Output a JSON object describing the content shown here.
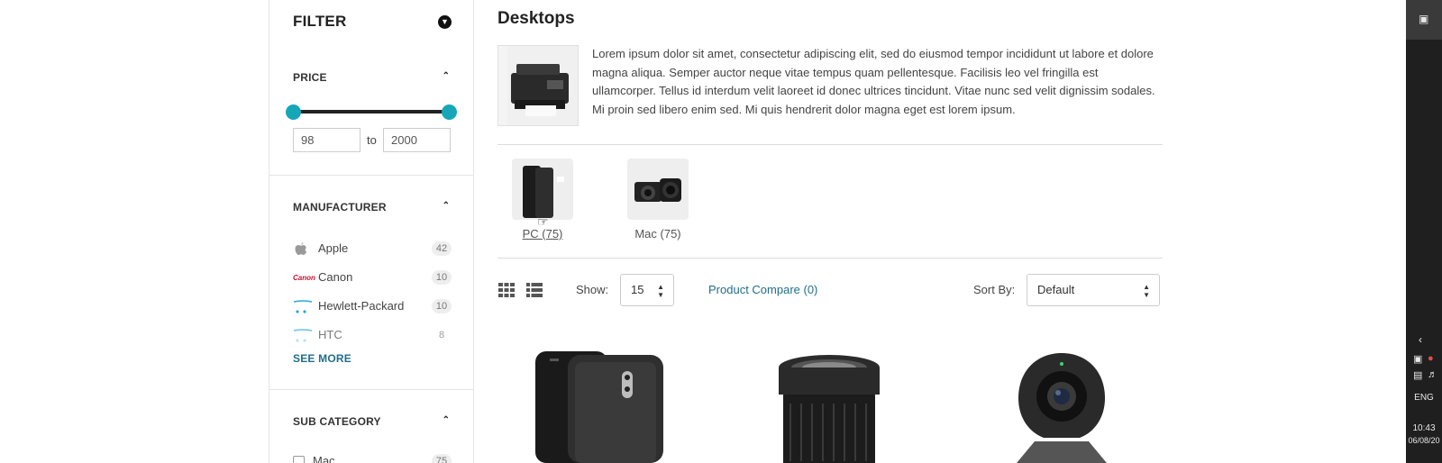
{
  "sidebar": {
    "filter_title": "FILTER",
    "price": {
      "title": "PRICE",
      "min_value": "98",
      "max_value": "2000",
      "to_label": "to",
      "accent": "#17a6b8"
    },
    "manufacturer": {
      "title": "MANUFACTURER",
      "items": [
        {
          "label": "Apple",
          "count": "42",
          "logo": "apple-logo"
        },
        {
          "label": "Canon",
          "count": "10",
          "logo": "Canon"
        },
        {
          "label": "Hewlett-Packard",
          "count": "10",
          "logo": "hp-logo"
        },
        {
          "label": "HTC",
          "count": "8",
          "logo": "htc-logo"
        }
      ],
      "see_more": "SEE MORE"
    },
    "sub_category": {
      "title": "SUB CATEGORY",
      "items": [
        {
          "label": "Mac",
          "count": "75"
        }
      ]
    }
  },
  "main": {
    "title": "Desktops",
    "description": "Lorem ipsum dolor sit amet, consectetur adipiscing elit, sed do eiusmod tempor incididunt ut labore et dolore magna aliqua. Semper auctor neque vitae tempus quam pellentesque. Facilisis leo vel fringilla est ullamcorper. Tellus id interdum velit laoreet id donec ultrices tincidunt. Vitae nunc sed velit dignissim sodales. Mi proin sed libero enim sed. Mi quis hendrerit dolor magna eget est lorem ipsum.",
    "subcategories": [
      {
        "label": "PC (75)"
      },
      {
        "label": "Mac (75)"
      }
    ],
    "toolbar": {
      "show_label": "Show:",
      "show_value": "15",
      "compare_label": "Product Compare (0)",
      "sort_label": "Sort By:",
      "sort_value": "Default"
    }
  },
  "taskbar": {
    "language": "ENG",
    "time": "10:43",
    "date": "06/08/20"
  },
  "colors": {
    "accent": "#17a6b8",
    "link": "#1f6e8c"
  }
}
